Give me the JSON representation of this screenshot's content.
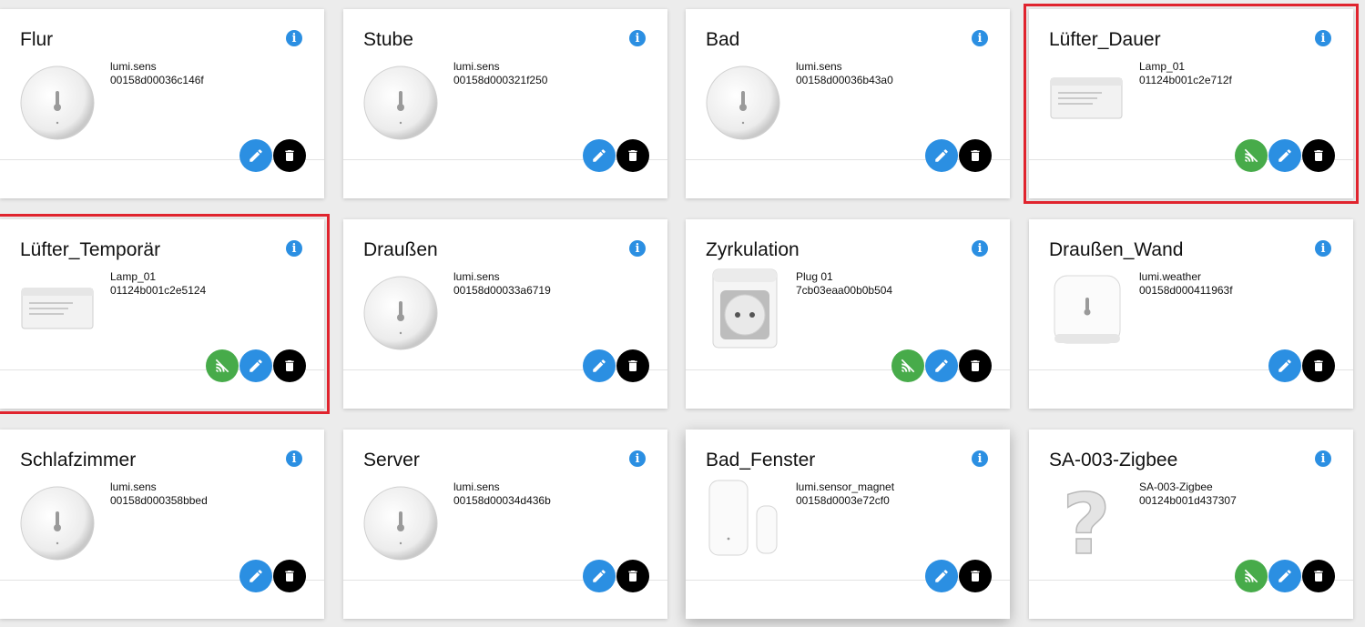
{
  "colors": {
    "info": "#2b8fe2",
    "edit": "#2b8fe2",
    "delete": "#000000",
    "zigbee": "#47ab4a",
    "highlight": "#e0242e"
  },
  "icons": {
    "info": "info-icon",
    "edit": "pencil-icon",
    "delete": "trash-icon",
    "zigbee": "zigbee-signal-icon"
  },
  "devices": [
    {
      "name": "Flur",
      "model": "lumi.sens",
      "id": "00158d00036c146f",
      "image": "round-sensor"
    },
    {
      "name": "Stube",
      "model": "lumi.sens",
      "id": "00158d000321f250",
      "image": "round-sensor"
    },
    {
      "name": "Bad",
      "model": "lumi.sens",
      "id": "00158d00036b43a0",
      "image": "round-sensor"
    },
    {
      "name": "Lüfter_Dauer",
      "model": "Lamp_01",
      "id": "01124b001c2e712f",
      "image": "controller-box",
      "highlighted": true,
      "zigbee_button": true
    },
    {
      "name": "Lüfter_Temporär",
      "model": "Lamp_01",
      "id": "01124b001c2e5124",
      "image": "controller-box",
      "highlighted": true,
      "zigbee_button": true
    },
    {
      "name": "Draußen",
      "model": "lumi.sens",
      "id": "00158d00033a6719",
      "image": "round-sensor"
    },
    {
      "name": "Zyrkulation",
      "model": "Plug 01",
      "id": "7cb03eaa00b0b504",
      "image": "plug",
      "zigbee_button": true
    },
    {
      "name": "Draußen_Wand",
      "model": "lumi.weather",
      "id": "00158d000411963f",
      "image": "square-sensor"
    },
    {
      "name": "Schlafzimmer",
      "model": "lumi.sens",
      "id": "00158d000358bbed",
      "image": "round-sensor"
    },
    {
      "name": "Server",
      "model": "lumi.sens",
      "id": "00158d00034d436b",
      "image": "round-sensor"
    },
    {
      "name": "Bad_Fenster",
      "model": "lumi.sensor_magnet",
      "id": "00158d0003e72cf0",
      "image": "door-sensor",
      "raised": true
    },
    {
      "name": "SA-003-Zigbee",
      "model": "SA-003-Zigbee",
      "id": "00124b001d437307",
      "image": "unknown",
      "zigbee_button": true
    }
  ]
}
